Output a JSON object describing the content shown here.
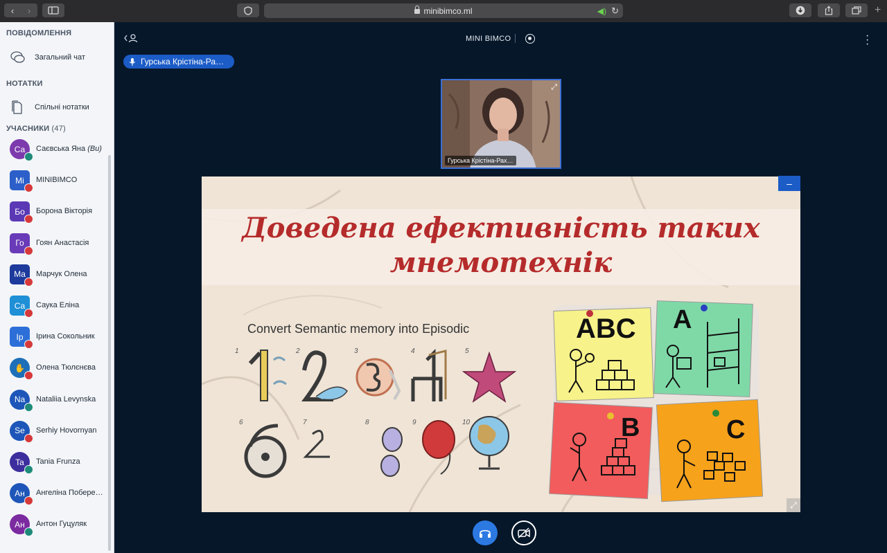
{
  "browser": {
    "url": "minibimco.ml",
    "back_label": "‹",
    "forward_label": "›"
  },
  "sidebar": {
    "messages_title": "ПОВІДОМЛЕННЯ",
    "public_chat": "Загальний чат",
    "notes_title": "НОТАТКИ",
    "shared_notes": "Спільні нотатки",
    "users_title": "УЧАСНИКИ",
    "users_count": "(47)",
    "users": [
      {
        "initials": "Са",
        "name": "Саєвська Яна",
        "you": "(Ви)",
        "color": "#7c3aad",
        "square": false,
        "badge": "#1e8a7a"
      },
      {
        "initials": "Mi",
        "name": "MINIBIMCO",
        "you": "",
        "color": "#2c5fc9",
        "square": true,
        "badge": "#d6393a"
      },
      {
        "initials": "Бо",
        "name": "Борона Вікторія",
        "you": "",
        "color": "#5b39b5",
        "square": true,
        "badge": "#d6393a"
      },
      {
        "initials": "Го",
        "name": "Гоян Анастасія",
        "you": "",
        "color": "#6a3bb8",
        "square": true,
        "badge": "#d6393a"
      },
      {
        "initials": "Ма",
        "name": "Марчук Олена",
        "you": "",
        "color": "#1d3a9c",
        "square": true,
        "badge": "#d6393a"
      },
      {
        "initials": "Са",
        "name": "Саука Еліна",
        "you": "",
        "color": "#1f8fd6",
        "square": true,
        "badge": "#d6393a"
      },
      {
        "initials": "Ір",
        "name": "Ірина Сокольник",
        "you": "",
        "color": "#2d6fd8",
        "square": true,
        "badge": "#d6393a"
      },
      {
        "initials": "✋",
        "name": "Олена Тюлєнєва",
        "you": "",
        "color": "#1d6fb8",
        "square": false,
        "badge": "#d6393a"
      },
      {
        "initials": "Na",
        "name": "Nataliia Levynska",
        "you": "",
        "color": "#1d56b8",
        "square": false,
        "badge": "#1e8a7a"
      },
      {
        "initials": "Se",
        "name": "Serhiy Hovornyan",
        "you": "",
        "color": "#1d56b8",
        "square": false,
        "badge": "#d6393a"
      },
      {
        "initials": "Ta",
        "name": "Tania Frunza",
        "you": "",
        "color": "#3d2e9e",
        "square": false,
        "badge": "#1e8a7a"
      },
      {
        "initials": "Ан",
        "name": "Ангеліна Побере…",
        "you": "",
        "color": "#1d56b8",
        "square": false,
        "badge": "#d6393a"
      },
      {
        "initials": "Ан",
        "name": "Антон Гуцуляк",
        "you": "",
        "color": "#7c2aa0",
        "square": false,
        "badge": "#1e8a7a"
      }
    ]
  },
  "main": {
    "title": "MINI BIMCO",
    "presenter_name": "Гурська Крістіна-Ра…",
    "video_name": "Гурська Крістіна-Рах…"
  },
  "slide": {
    "title_line1": "Доведена ефективність таких",
    "title_line2": "мнемотехнік",
    "subtitle": "Convert Semantic memory into Episodic",
    "numbers": [
      "1",
      "2",
      "3",
      "4",
      "5",
      "6",
      "7",
      "8",
      "9",
      "10"
    ],
    "notes": [
      {
        "letter": "ABC",
        "color": "#f7f28a"
      },
      {
        "letter": "A",
        "color": "#7fd9a7"
      },
      {
        "letter": "B",
        "color": "#f25c5c"
      },
      {
        "letter": "C",
        "color": "#f7a21b"
      }
    ]
  },
  "colors": {
    "accent": "#1c5cc7",
    "title_red": "#b52b2b"
  }
}
